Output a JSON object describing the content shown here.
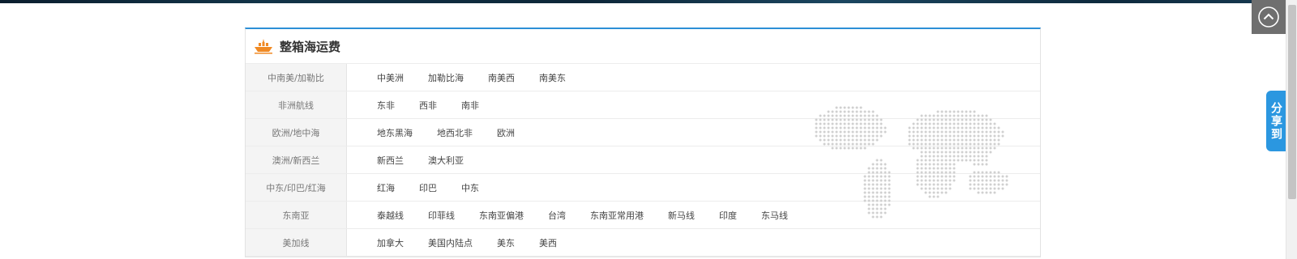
{
  "panel": {
    "title": "整箱海运费",
    "icon": "ship-icon",
    "accent_color": "#2c8fd6",
    "icon_color": "#f08a24"
  },
  "routes": [
    {
      "region": "中南美/加勒比",
      "links": [
        "中美洲",
        "加勒比海",
        "南美西",
        "南美东"
      ]
    },
    {
      "region": "非洲航线",
      "links": [
        "东非",
        "西非",
        "南非"
      ]
    },
    {
      "region": "欧洲/地中海",
      "links": [
        "地东黑海",
        "地西北非",
        "欧洲"
      ]
    },
    {
      "region": "澳洲/新西兰",
      "links": [
        "新西兰",
        "澳大利亚"
      ]
    },
    {
      "region": "中东/印巴/红海",
      "links": [
        "红海",
        "印巴",
        "中东"
      ]
    },
    {
      "region": "东南亚",
      "links": [
        "泰越线",
        "印菲线",
        "东南亚偏港",
        "台湾",
        "东南亚常用港",
        "新马线",
        "印度",
        "东马线"
      ]
    },
    {
      "region": "美加线",
      "links": [
        "加拿大",
        "美国内陆点",
        "美东",
        "美西"
      ]
    }
  ],
  "side": {
    "back_to_top_icon": "chevron-up-icon",
    "share_label": "分享到",
    "share_color": "#2b97e0"
  },
  "decor": {
    "map_icon": "dotted-world-map-icon"
  }
}
